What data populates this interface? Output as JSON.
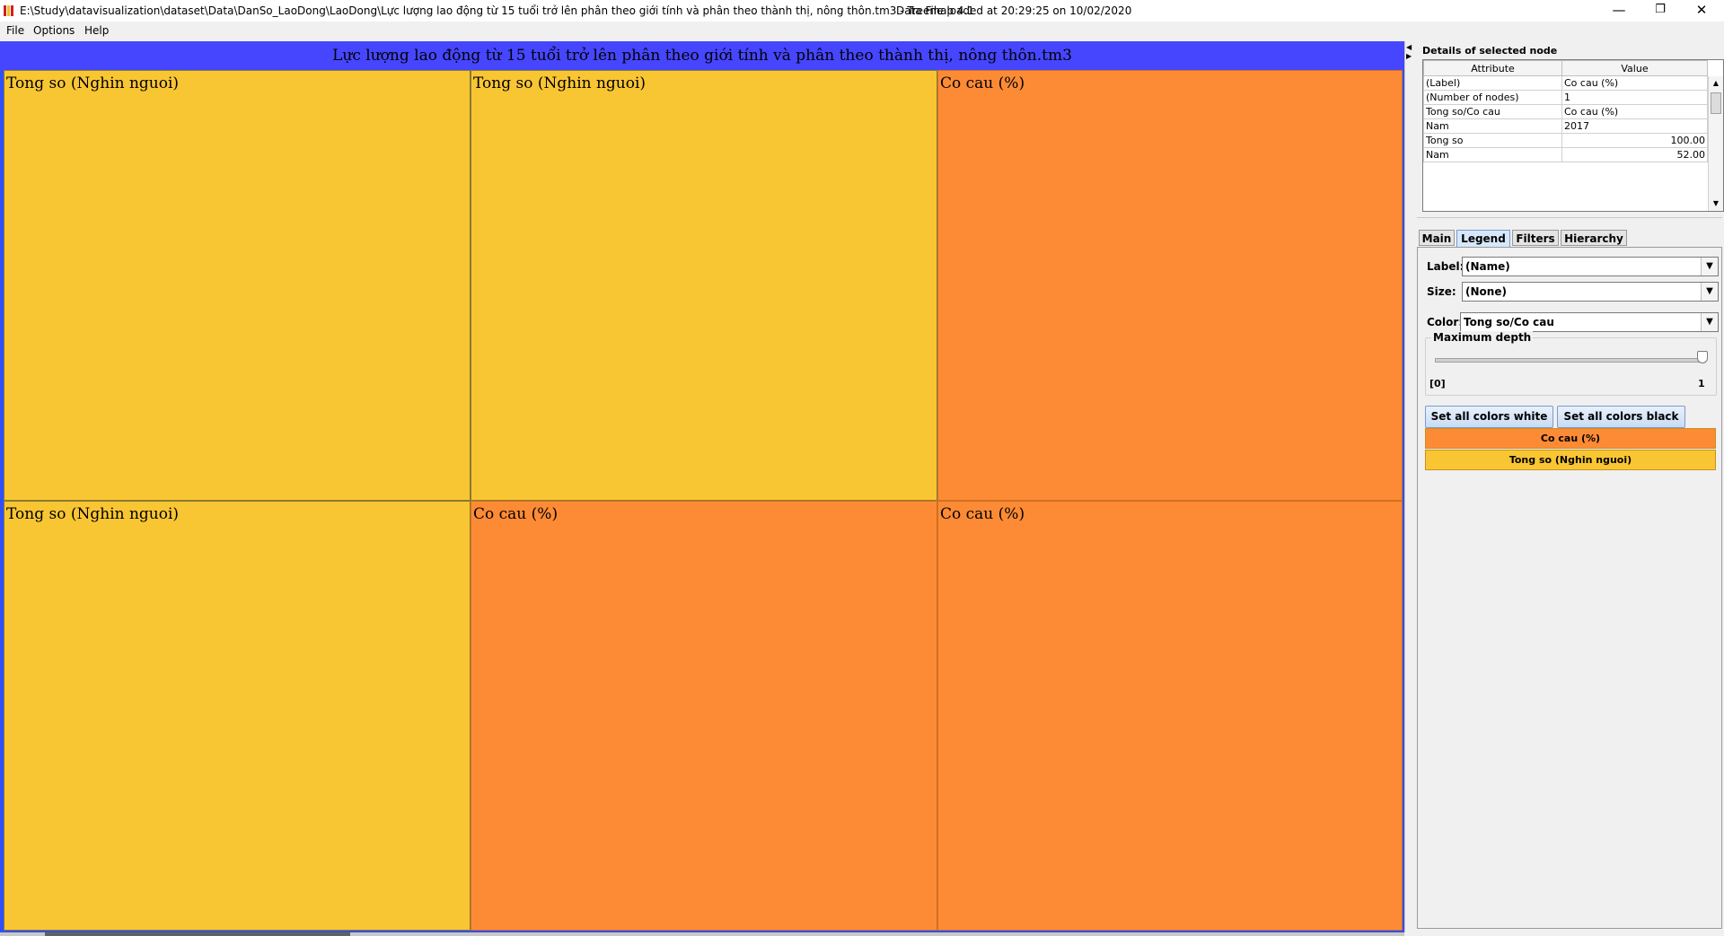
{
  "window": {
    "title": "E:\\Study\\datavisualization\\dataset\\Data\\DanSo_LaoDong\\LaoDong\\Lực lượng lao động từ 15 tuổi trở lên phân theo giới tính và phân theo thành thị, nông thôn.tm3 - Treemap 4.1",
    "status": "Data File loaded at 20:29:25 on 10/02/2020",
    "minimize": "—",
    "restore": "❐",
    "close": "✕"
  },
  "menu": {
    "file": "File",
    "options": "Options",
    "help": "Help"
  },
  "treemap": {
    "header": "Lực lượng lao động từ 15 tuổi trở lên phân theo giới tính và phân theo thành thị, nông thôn.tm3",
    "cells": [
      {
        "label": "Tong so (Nghin nguoi)",
        "color": "#f9c633"
      },
      {
        "label": "Tong so (Nghin nguoi)",
        "color": "#f9c633"
      },
      {
        "label": "Co cau (%)",
        "color": "#fd8b35"
      },
      {
        "label": "Tong so (Nghin nguoi)",
        "color": "#f9c633"
      },
      {
        "label": "Co cau (%)",
        "color": "#fd8b35"
      },
      {
        "label": "Co cau (%)",
        "color": "#fd8b35"
      }
    ]
  },
  "details": {
    "title": "Details of selected node",
    "columns": [
      "Attribute",
      "Value"
    ],
    "rows": [
      {
        "attr": "(Label)",
        "value": "Co cau (%)"
      },
      {
        "attr": "(Number of nodes)",
        "value": "1"
      },
      {
        "attr": "Tong so/Co cau",
        "value": "Co cau (%)"
      },
      {
        "attr": "Nam",
        "value": "2017"
      },
      {
        "attr": "Tong so",
        "value": "100.00"
      },
      {
        "attr": "Nam",
        "value": "52.00"
      }
    ]
  },
  "tabs": [
    "Main",
    "Legend",
    "Filters",
    "Hierarchy"
  ],
  "legend": {
    "label_label": "Label:",
    "label_value": "(Name)",
    "size_label": "Size:",
    "size_value": "(None)",
    "color_label": "Color:",
    "color_value": "Tong so/Co cau",
    "depth_title": "Maximum depth",
    "depth_min": "[0]",
    "depth_max": "1",
    "depth_level": 1,
    "btn_white": "Set all colors white",
    "btn_black": "Set all colors black",
    "entries": [
      {
        "label": "Co cau (%)",
        "color": "#fd8b35"
      },
      {
        "label": "Tong so (Nghin nguoi)",
        "color": "#f9c633"
      }
    ]
  },
  "colors": {
    "header": "#4646ff",
    "yellow": "#f9c633",
    "orange": "#fd8b35"
  }
}
